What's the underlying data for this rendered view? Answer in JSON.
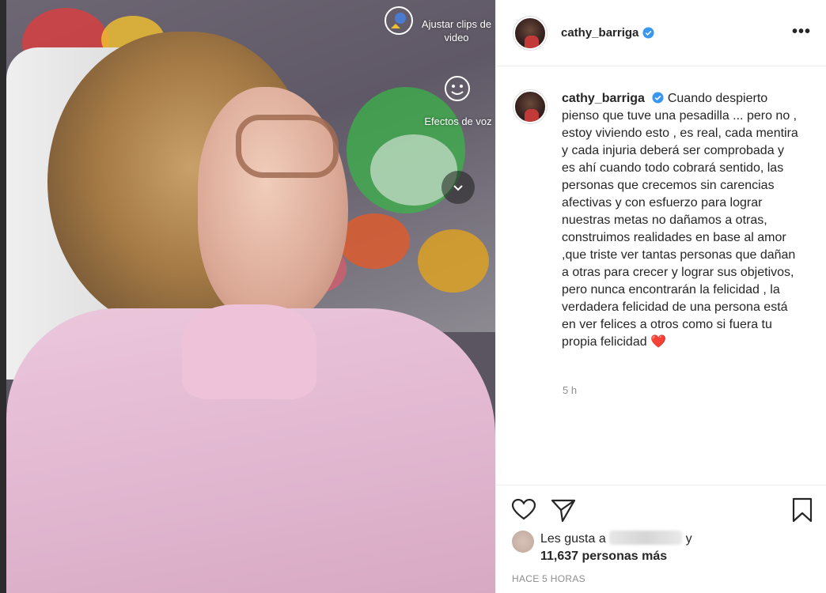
{
  "media": {
    "overlay": {
      "adjust_clips_label": "Ajustar clips de video",
      "voice_effects_label": "Efectos de voz"
    }
  },
  "post": {
    "username": "cathy_barriga",
    "verified": true,
    "caption": "Cuando despierto pienso que tuve una pesadilla ... pero no , estoy viviendo esto , es real, cada mentira y cada injuria deberá ser comprobada y es ahí cuando todo cobrará sentido, las personas que crecemos sin carencias afectivas y con esfuerzo para lograr nuestras metas no dañamos a otras, construimos realidades en base al amor ,que triste ver tantas personas que dañan a otras para crecer y lograr sus objetivos, pero nunca encontrarán la felicidad , la verdadera felicidad de una persona está en ver felices a otros como si fuera tu propia felicidad",
    "caption_emoji": "❤️",
    "caption_time": "5 h",
    "likes_prefix": "Les gusta a",
    "likes_suffix": "y",
    "likes_count": "11,637 personas más",
    "post_date": "HACE 5 HORAS"
  },
  "icons": {
    "more": "more-options-icon",
    "like": "heart-icon",
    "share": "paper-plane-icon",
    "save": "bookmark-icon",
    "verified": "verified-badge-icon"
  },
  "colors": {
    "verified_blue": "#3897f0",
    "secondary_text": "#8e8e8e",
    "heart_red": "#e0245e"
  }
}
